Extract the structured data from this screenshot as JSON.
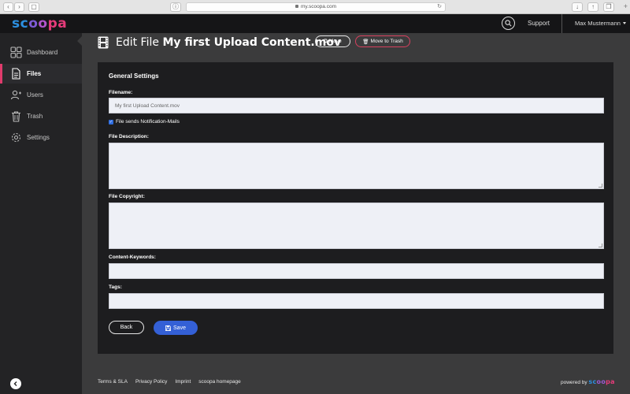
{
  "browser": {
    "url": "my.scoopa.com"
  },
  "app": {
    "logo": {
      "part1": "sc",
      "part2": "o",
      "part3": "o",
      "part4": "pa"
    },
    "support_label": "Support",
    "user_name": "Max Mustermann"
  },
  "sidebar": {
    "items": [
      {
        "label": "Dashboard",
        "icon": "grid-icon"
      },
      {
        "label": "Files",
        "icon": "file-icon",
        "active": true
      },
      {
        "label": "Users",
        "icon": "user-add-icon"
      },
      {
        "label": "Trash",
        "icon": "trash-icon"
      },
      {
        "label": "Settings",
        "icon": "gear-icon"
      }
    ]
  },
  "header": {
    "title_prefix": "Edit File",
    "title_name": "My first Upload Content.mov",
    "move_label": "Move",
    "trash_label": "Move to Trash"
  },
  "form": {
    "section_title": "General Settings",
    "filename_label": "Filename:",
    "filename_value": "My first Upload Content.mov",
    "notification_label": "File sends Notification-Mails",
    "notification_checked": true,
    "description_label": "File Description:",
    "copyright_label": "File Copyright:",
    "keywords_label": "Content-Keywords:",
    "tags_label": "Tags:",
    "back_label": "Back",
    "save_label": "Save"
  },
  "footer": {
    "links": [
      "Terms & SLA",
      "Privacy Policy",
      "Imprint",
      "scoopa homepage"
    ],
    "powered_by": "powered by",
    "powered_logo": {
      "part1": "sc",
      "part2": "oo",
      "part3": "pa"
    }
  },
  "colors": {
    "accent_pink": "#e03b6c",
    "save_blue": "#3460d6",
    "sidebar_bg": "#232325",
    "panel_bg": "#1d1d1f"
  }
}
